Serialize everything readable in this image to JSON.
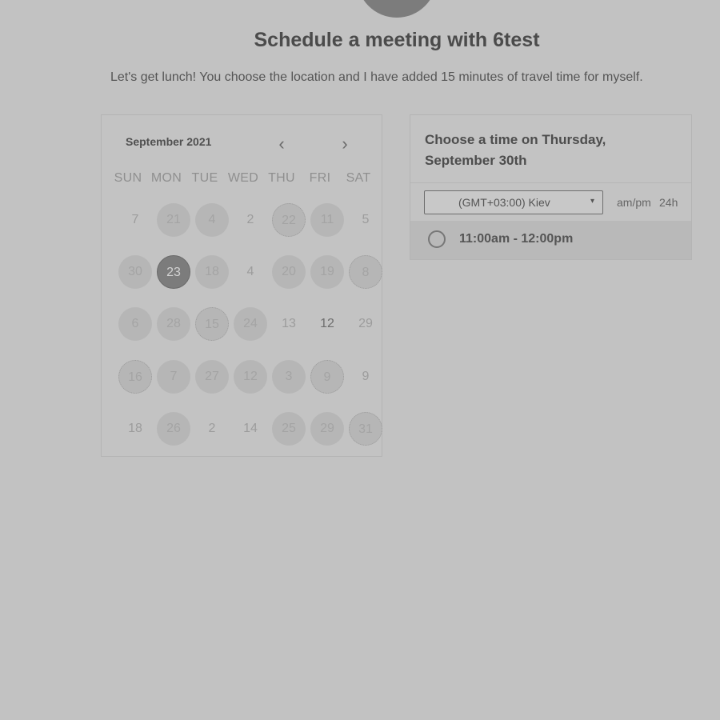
{
  "header": {
    "title": "Schedule a meeting with 6test",
    "description": "Let's get lunch! You choose the location and I have added 15 minutes of travel time for myself."
  },
  "calendar": {
    "month": "September 2021",
    "prev_icon": "‹",
    "next_icon": "›",
    "weekdays": [
      "SUN",
      "MON",
      "TUE",
      "WED",
      "THU",
      "FRI",
      "SAT"
    ],
    "weeks": [
      [
        "7",
        "21",
        "4",
        "2",
        "22",
        "11",
        "5"
      ],
      [
        "30",
        "23",
        "18",
        "4",
        "20",
        "19",
        "8"
      ],
      [
        "6",
        "28",
        "15",
        "24",
        "13",
        "12",
        "29"
      ],
      [
        "16",
        "7",
        "27",
        "12",
        "3",
        "9",
        "9"
      ],
      [
        "18",
        "26",
        "2",
        "14",
        "25",
        "29",
        "31"
      ]
    ],
    "selected": "23"
  },
  "times": {
    "heading": "Choose a time on Thursday, September 30th",
    "timezone": "(GMT+03:00) Kiev",
    "caret_icon": "▾",
    "format_12": "am/pm",
    "format_24": "24h",
    "slots": [
      "11:00am - 12:00pm"
    ]
  }
}
